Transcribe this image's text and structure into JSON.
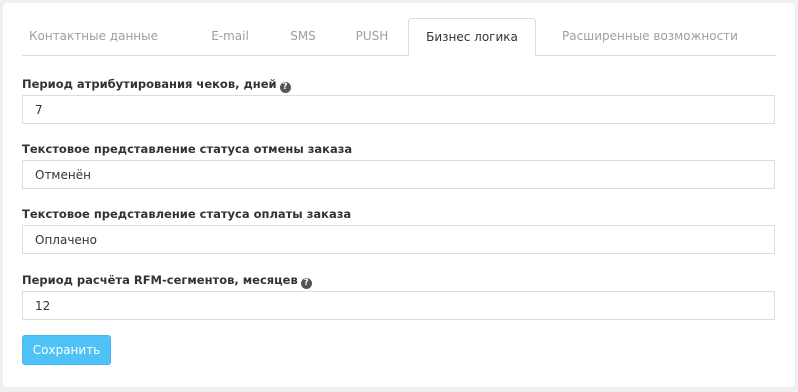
{
  "tabs": [
    {
      "label": "Контактные данные"
    },
    {
      "label": "E-mail"
    },
    {
      "label": "SMS"
    },
    {
      "label": "PUSH"
    },
    {
      "label": "Бизнес логика"
    },
    {
      "label": "Расширенные возможности"
    }
  ],
  "active_tab": "Бизнес логика",
  "form": {
    "attribution": {
      "label": "Период атрибутирования чеков, дней",
      "value": "7",
      "help_icon": "question-circle-icon"
    },
    "cancel_status": {
      "label": "Текстовое представление статуса отмены заказа",
      "value": "Отменён"
    },
    "paid_status": {
      "label": "Текстовое представление статуса оплаты заказа",
      "value": "Оплачено"
    },
    "rfm_period": {
      "label": "Период расчёта RFM-сегментов, месяцев",
      "value": "12",
      "help_icon": "question-circle-icon"
    },
    "save_label": "Сохранить"
  },
  "colors": {
    "background": "#f0f0f0",
    "panel": "#ffffff",
    "border": "#dddddd",
    "accent": "#4fc3f7",
    "tab_inactive_text": "#9aa0a6",
    "text": "#333333"
  }
}
